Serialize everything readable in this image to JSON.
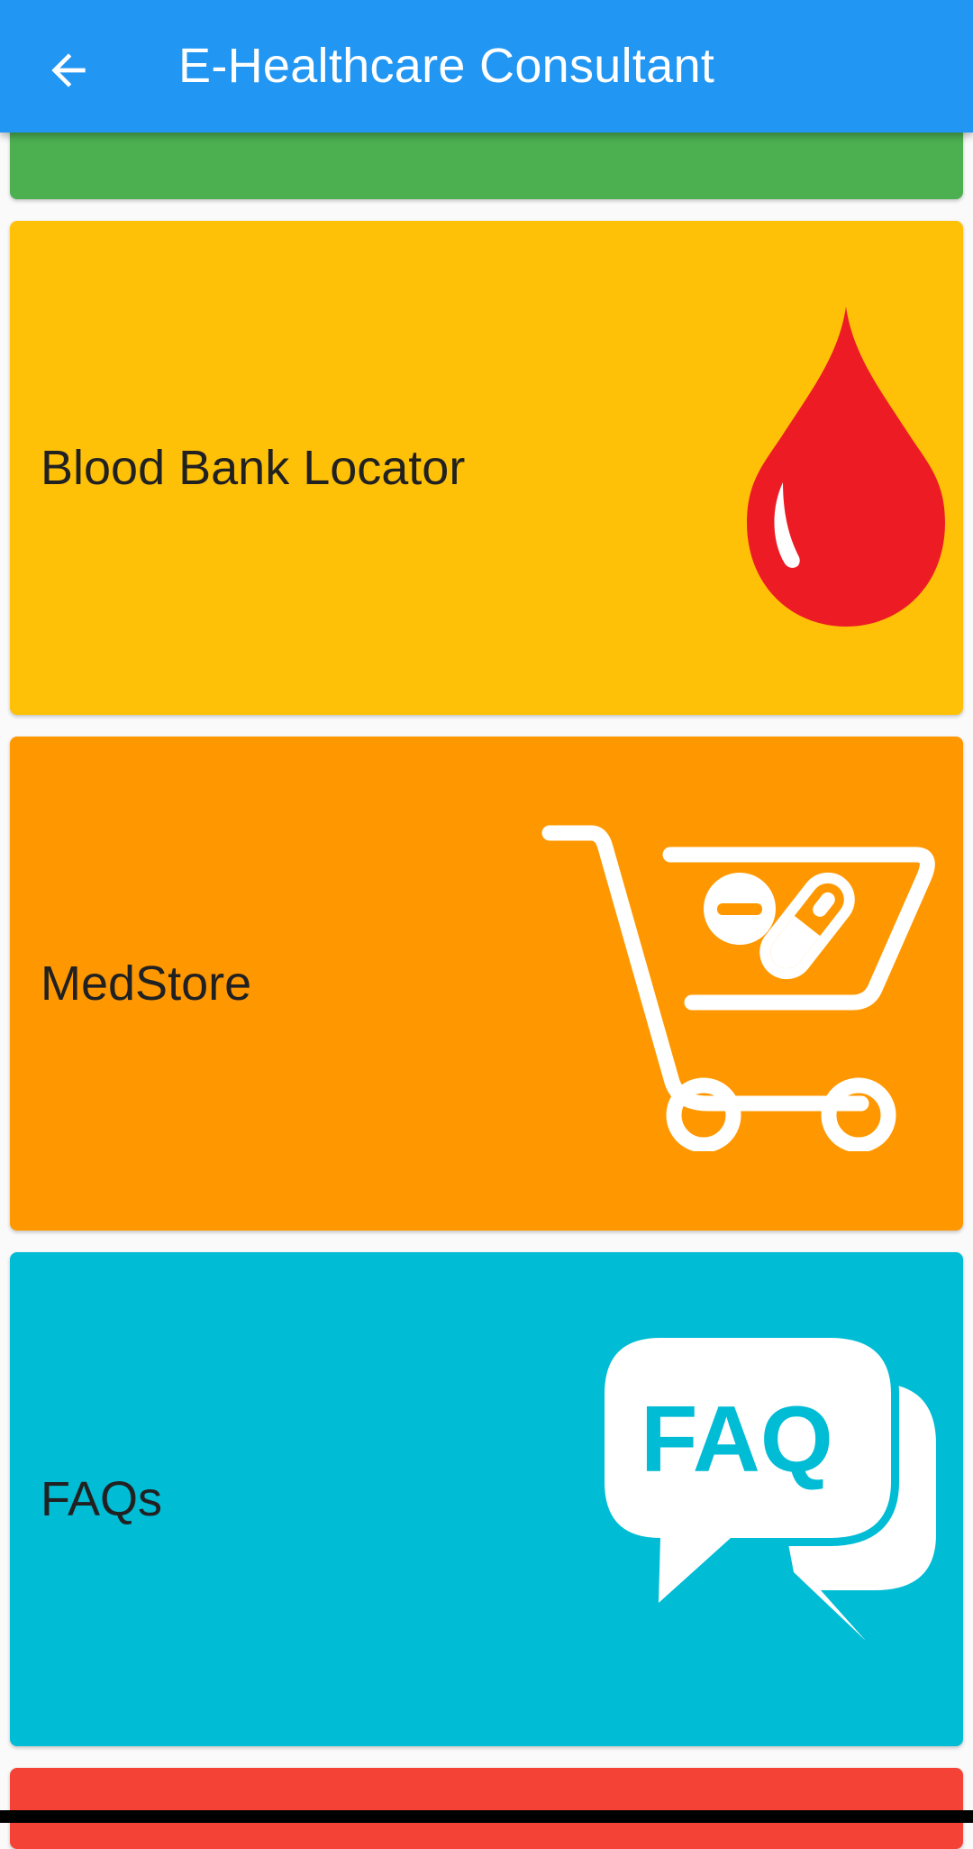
{
  "appbar": {
    "title": "E-Healthcare Consultant",
    "back_icon": "arrow-back-icon",
    "color": "#2196F3"
  },
  "cards": [
    {
      "label": "",
      "color": "#4CAF50"
    },
    {
      "label": "Blood Bank Locator",
      "color": "#FFC107",
      "icon": "blood-drop-icon"
    },
    {
      "label": "MedStore",
      "color": "#FF9800",
      "icon": "shopping-cart-pills-icon"
    },
    {
      "label": "FAQs",
      "color": "#00BCD4",
      "icon": "faq-speech-bubble-icon"
    },
    {
      "label": "",
      "color": "#F44336"
    }
  ]
}
